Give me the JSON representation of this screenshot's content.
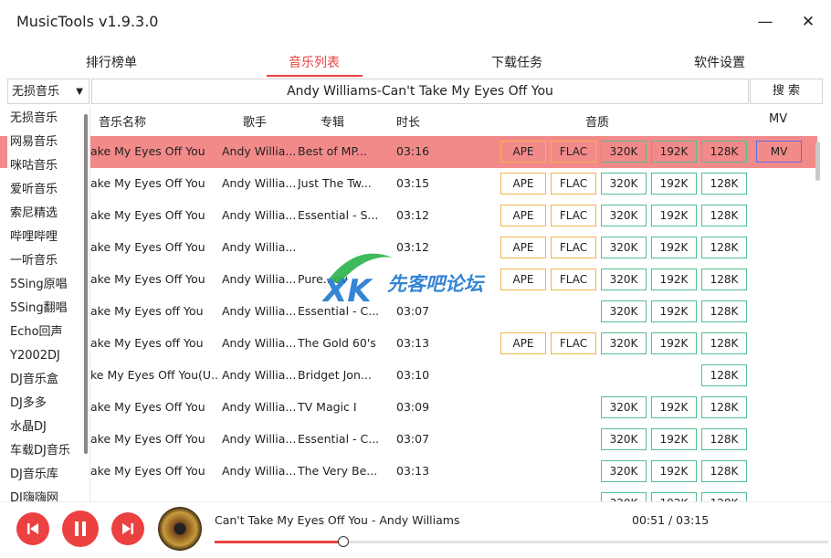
{
  "app": {
    "title": "MusicTools v1.9.3.0"
  },
  "tabs": [
    "排行榜单",
    "音乐列表",
    "下载任务",
    "软件设置"
  ],
  "search": {
    "source": "无损音乐",
    "query": "Andy Williams-Can't Take My Eyes Off You",
    "button": "搜 索"
  },
  "sources": [
    "无损音乐",
    "网易音乐",
    "咪咕音乐",
    "爱听音乐",
    "索尼精选",
    "哔哩哔哩",
    "一听音乐",
    "5Sing原唱",
    "5Sing翻唱",
    "Echo回声",
    "Y2002DJ",
    "DJ音乐盒",
    "DJ多多",
    "水晶DJ",
    "车载DJ音乐",
    "DJ音乐库",
    "DJ嗨嗨网"
  ],
  "columns": {
    "name": "音乐名称",
    "artist": "歌手",
    "album": "专辑",
    "duration": "时长",
    "quality": "音质",
    "mv": "MV"
  },
  "quality_labels": {
    "ape": "APE",
    "flac": "FLAC",
    "q320": "320K",
    "q192": "192K",
    "q128": "128K",
    "mv": "MV"
  },
  "songs": [
    {
      "name": "ake My Eyes Off You",
      "artist": "Andy Willia...",
      "album": "Best of MP...",
      "duration": "03:16",
      "ape": true,
      "flac": true,
      "q320": true,
      "q192": true,
      "q128": true,
      "mv": true,
      "highlight": true
    },
    {
      "name": "ake My Eyes Off You",
      "artist": "Andy Willia...",
      "album": "Just The Tw...",
      "duration": "03:15",
      "ape": true,
      "flac": true,
      "q320": true,
      "q192": true,
      "q128": true,
      "mv": false
    },
    {
      "name": "ake My Eyes Off You",
      "artist": "Andy Willia...",
      "album": "Essential - S...",
      "duration": "03:12",
      "ape": true,
      "flac": true,
      "q320": true,
      "q192": true,
      "q128": true,
      "mv": false
    },
    {
      "name": "ake My Eyes Off You",
      "artist": "Andy Willia...",
      "album": "",
      "duration": "03:12",
      "ape": true,
      "flac": true,
      "q320": true,
      "q192": true,
      "q128": true,
      "mv": false
    },
    {
      "name": "ake My Eyes Off You",
      "artist": "Andy Willia...",
      "album": "Pure...ov",
      "duration": "",
      "ape": true,
      "flac": true,
      "q320": true,
      "q192": true,
      "q128": true,
      "mv": false
    },
    {
      "name": "ake My Eyes off You",
      "artist": "Andy Willia...",
      "album": "Essential - C...",
      "duration": "03:07",
      "ape": false,
      "flac": false,
      "q320": true,
      "q192": true,
      "q128": true,
      "mv": false
    },
    {
      "name": "ake My Eyes off You",
      "artist": "Andy Willia...",
      "album": "The Gold 60's",
      "duration": "03:13",
      "ape": true,
      "flac": true,
      "q320": true,
      "q192": true,
      "q128": true,
      "mv": false
    },
    {
      "name": "ke My Eyes Off You(U...",
      "artist": "Andy Willia...",
      "album": "Bridget Jon...",
      "duration": "03:10",
      "ape": false,
      "flac": false,
      "q320": false,
      "q192": false,
      "q128": true,
      "mv": false
    },
    {
      "name": "ake My Eyes Off You",
      "artist": "Andy Willia...",
      "album": "TV Magic I",
      "duration": "03:09",
      "ape": false,
      "flac": false,
      "q320": true,
      "q192": true,
      "q128": true,
      "mv": false
    },
    {
      "name": "ake My Eyes Off You",
      "artist": "Andy Willia...",
      "album": "Essential - C...",
      "duration": "03:07",
      "ape": false,
      "flac": false,
      "q320": true,
      "q192": true,
      "q128": true,
      "mv": false
    },
    {
      "name": "ake My Eyes Off You",
      "artist": "Andy Willia...",
      "album": "The Very Be...",
      "duration": "03:13",
      "ape": false,
      "flac": false,
      "q320": true,
      "q192": true,
      "q128": true,
      "mv": false
    },
    {
      "name": "",
      "artist": "",
      "album": "",
      "duration": "",
      "ape": false,
      "flac": false,
      "q320": true,
      "q192": true,
      "q128": true,
      "mv": false
    }
  ],
  "watermark": "先客吧论坛",
  "player": {
    "now_playing": "Can't Take My Eyes Off You - Andy Williams",
    "time": "00:51 / 03:15",
    "progress": 0.2099
  },
  "colors": {
    "accent": "#ec4141",
    "highlight_row": "#f38a8a",
    "gold_border": "#f0b64b",
    "green_border": "#52c08b",
    "mv_border": "#5a6ee8"
  }
}
